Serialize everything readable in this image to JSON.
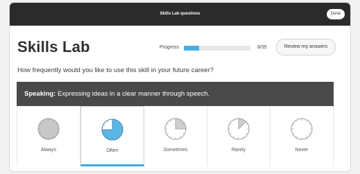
{
  "header": {
    "title": "Skills Lab questions",
    "done_label": "Done"
  },
  "page": {
    "title": "Skills Lab"
  },
  "progress": {
    "label": "Progress",
    "current": 8,
    "total": 35,
    "count_text": "8/35",
    "fraction": 0.2286
  },
  "review_label": "Review my answers",
  "question": "How frequently would you like to use this skill in your future career?",
  "skill": {
    "name": "Speaking:",
    "description": " Expressing ideas in a clear manner through speech."
  },
  "options": [
    {
      "label": "Always",
      "level": 1.0,
      "selected": false,
      "color": "#c8c8c8"
    },
    {
      "label": "Often",
      "level": 0.75,
      "selected": true,
      "color": "#5ab7e6"
    },
    {
      "label": "Sometimes",
      "level": 0.25,
      "selected": false,
      "color": "#cfcfcf"
    },
    {
      "label": "Rarely",
      "level": 0.125,
      "selected": false,
      "color": "#cfcfcf"
    },
    {
      "label": "Never",
      "level": 0.0,
      "selected": false,
      "color": "#cfcfcf"
    }
  ],
  "colors": {
    "accent": "#44b0e0",
    "dark_bar": "#494949",
    "top_bar": "#2b2b2b"
  }
}
